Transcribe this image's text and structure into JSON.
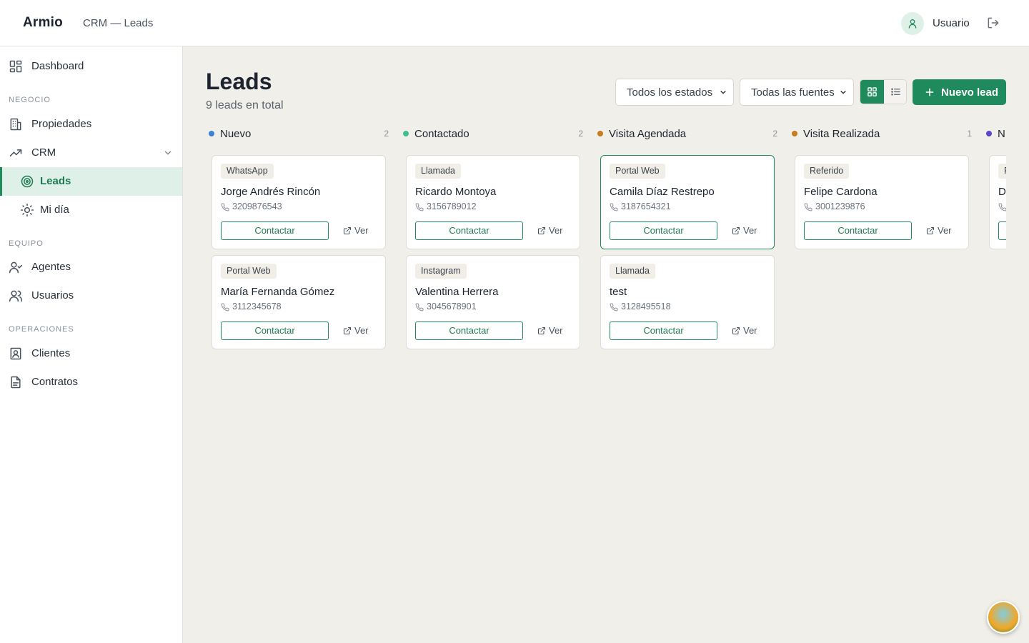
{
  "app": {
    "brand": "Armio",
    "breadcrumb": "CRM — Leads"
  },
  "user": {
    "name": "Usuario"
  },
  "sidebar": {
    "dashboard": "Dashboard",
    "section_negocio": "NEGOCIO",
    "propiedades": "Propiedades",
    "crm": "CRM",
    "leads": "Leads",
    "mi_dia": "Mi día",
    "section_equipo": "EQUIPO",
    "agentes": "Agentes",
    "usuarios": "Usuarios",
    "section_operaciones": "OPERACIONES",
    "clientes": "Clientes",
    "contratos": "Contratos"
  },
  "main": {
    "title": "Leads",
    "subtitle": "9 leads en total",
    "filter_status": "Todos los estados",
    "filter_source": "Todas las fuentes",
    "new_lead": "Nuevo lead"
  },
  "card_actions": {
    "contact": "Contactar",
    "view": "Ver"
  },
  "columns": [
    {
      "title": "Nuevo",
      "count": "2",
      "color": "#3b82d6",
      "cards": [
        {
          "source": "WhatsApp",
          "name": "Jorge Andrés Rincón",
          "phone": "3209876543"
        },
        {
          "source": "Portal Web",
          "name": "María Fernanda Gómez",
          "phone": "3112345678"
        }
      ]
    },
    {
      "title": "Contactado",
      "count": "2",
      "color": "#3fbf8f",
      "cards": [
        {
          "source": "Llamada",
          "name": "Ricardo Montoya",
          "phone": "3156789012"
        },
        {
          "source": "Instagram",
          "name": "Valentina Herrera",
          "phone": "3045678901"
        }
      ]
    },
    {
      "title": "Visita Agendada",
      "count": "2",
      "color": "#c97a1e",
      "cards": [
        {
          "source": "Portal Web",
          "name": "Camila Díaz Restrepo",
          "phone": "3187654321"
        },
        {
          "source": "Llamada",
          "name": "test",
          "phone": "3128495518"
        }
      ]
    },
    {
      "title": "Visita Realizada",
      "count": "1",
      "color": "#c97a1e",
      "cards": [
        {
          "source": "Referido",
          "name": "Felipe Cardona",
          "phone": "3001239876"
        }
      ]
    },
    {
      "title": "N",
      "count": "",
      "color": "#5b45c9",
      "cards": [
        {
          "source": "F",
          "name": "D",
          "phone": ""
        }
      ]
    }
  ]
}
